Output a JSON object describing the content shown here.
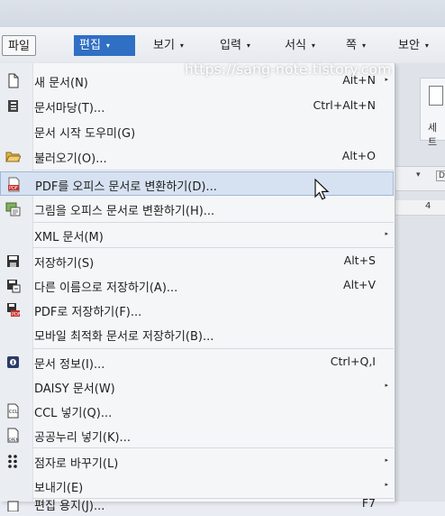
{
  "menubar": {
    "items": [
      {
        "label": "파일",
        "has_caret": false
      },
      {
        "label": "편집",
        "has_caret": true
      },
      {
        "label": "보기",
        "has_caret": true
      },
      {
        "label": "입력",
        "has_caret": true
      },
      {
        "label": "서식",
        "has_caret": true
      },
      {
        "label": "쪽",
        "has_caret": true
      },
      {
        "label": "보안",
        "has_caret": true
      }
    ],
    "caret": "▾"
  },
  "watermark": "https://sang-note.tistory.com",
  "ribbon": {
    "partial_label": "세트",
    "dropdown_glyph": "▾",
    "dropdown_glyph2": "D",
    "ruler_number": "4"
  },
  "file_menu": {
    "items": [
      {
        "label": "새 문서(N)",
        "shortcut": "Alt+N",
        "submenu": true,
        "icon": "new-document-icon"
      },
      {
        "label": "문서마당(T)...",
        "shortcut": "Ctrl+Alt+N",
        "submenu": false,
        "icon": "template-icon"
      },
      {
        "label": "문서 시작 도우미(G)",
        "shortcut": "",
        "submenu": false,
        "icon": ""
      },
      {
        "label": "불러오기(O)...",
        "shortcut": "Alt+O",
        "submenu": false,
        "icon": "open-folder-icon"
      },
      {
        "label": "PDF를 오피스 문서로 변환하기(D)...",
        "shortcut": "",
        "submenu": false,
        "icon": "pdf-convert-icon",
        "highlighted": true
      },
      {
        "label": "그림을 오피스 문서로 변환하기(H)...",
        "shortcut": "",
        "submenu": false,
        "icon": "image-convert-icon"
      },
      {
        "label": "XML 문서(M)",
        "shortcut": "",
        "submenu": true,
        "icon": ""
      },
      {
        "label": "저장하기(S)",
        "shortcut": "Alt+S",
        "submenu": false,
        "icon": "save-icon"
      },
      {
        "label": "다른 이름으로 저장하기(A)...",
        "shortcut": "Alt+V",
        "submenu": false,
        "icon": "save-as-icon"
      },
      {
        "label": "PDF로 저장하기(F)...",
        "shortcut": "",
        "submenu": false,
        "icon": "pdf-save-icon"
      },
      {
        "label": "모바일 최적화 문서로 저장하기(B)...",
        "shortcut": "",
        "submenu": false,
        "icon": ""
      },
      {
        "label": "문서 정보(I)...",
        "shortcut": "Ctrl+Q,I",
        "submenu": false,
        "icon": "document-info-icon"
      },
      {
        "label": "DAISY 문서(W)",
        "shortcut": "",
        "submenu": true,
        "icon": ""
      },
      {
        "label": "CCL 넣기(Q)...",
        "shortcut": "",
        "submenu": false,
        "icon": "ccl-icon"
      },
      {
        "label": "공공누리 넣기(K)...",
        "shortcut": "",
        "submenu": false,
        "icon": "kogl-icon"
      },
      {
        "label": "점자로 바꾸기(L)",
        "shortcut": "",
        "submenu": true,
        "icon": "braille-icon"
      },
      {
        "label": "보내기(E)",
        "shortcut": "",
        "submenu": true,
        "icon": ""
      },
      {
        "label": "편집 용지(J)...",
        "shortcut": "F7",
        "submenu": false,
        "icon": "page-setup-icon"
      }
    ],
    "submenu_arrow": "▸"
  }
}
